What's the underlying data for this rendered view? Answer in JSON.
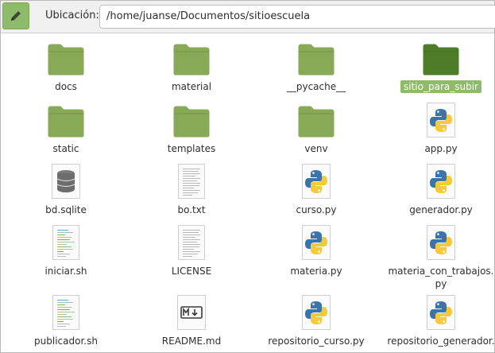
{
  "toolbar": {
    "edit_icon": "pencil-icon",
    "location_label": "Ubicación:",
    "location_value": "/home/juanse/Documentos/sitioescuela"
  },
  "colors": {
    "folder": "#88a956",
    "folder_selected": "#4e7d2a",
    "selection": "#8ebb6a",
    "python_blue": "#3b74a8",
    "python_yellow": "#f4c93b"
  },
  "files": [
    {
      "name": "docs",
      "type": "folder"
    },
    {
      "name": "material",
      "type": "folder"
    },
    {
      "name": "__pycache__",
      "type": "folder"
    },
    {
      "name": "sitio_para_subir",
      "type": "folder",
      "selected": true
    },
    {
      "name": "static",
      "type": "folder"
    },
    {
      "name": "templates",
      "type": "folder"
    },
    {
      "name": "venv",
      "type": "folder"
    },
    {
      "name": "app.py",
      "type": "python"
    },
    {
      "name": "bd.sqlite",
      "type": "database"
    },
    {
      "name": "bo.txt",
      "type": "text"
    },
    {
      "name": "curso.py",
      "type": "python"
    },
    {
      "name": "generador.py",
      "type": "python"
    },
    {
      "name": "iniciar.sh",
      "type": "script"
    },
    {
      "name": "LICENSE",
      "type": "text"
    },
    {
      "name": "materia.py",
      "type": "python"
    },
    {
      "name": "materia_con_trabajos.\npy",
      "type": "python"
    },
    {
      "name": "publicador.sh",
      "type": "script"
    },
    {
      "name": "README.md",
      "type": "markdown"
    },
    {
      "name": "repositorio_curso.py",
      "type": "python"
    },
    {
      "name": "repositorio_generador.",
      "type": "python"
    }
  ]
}
